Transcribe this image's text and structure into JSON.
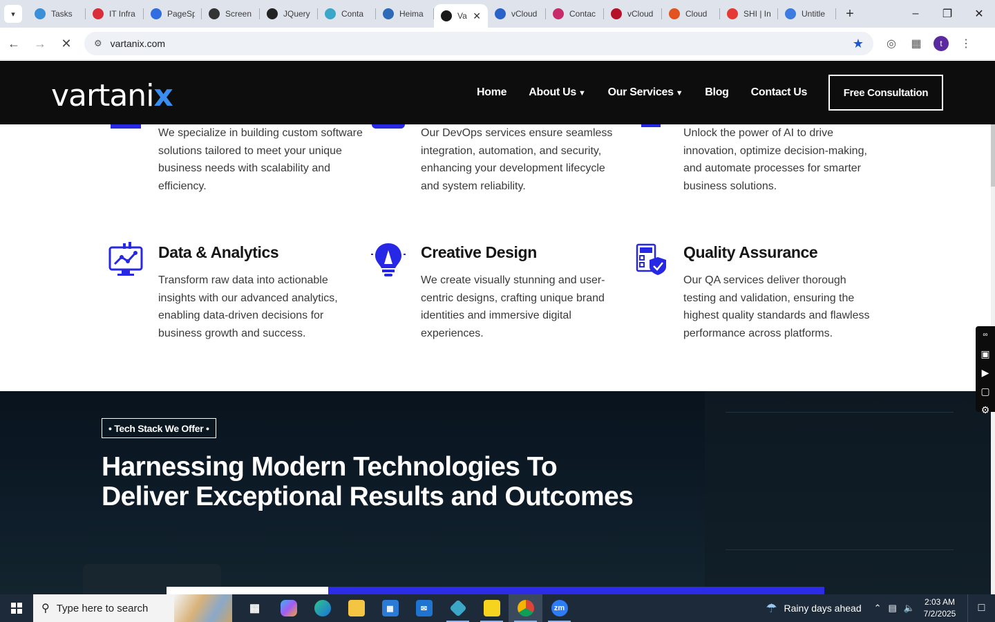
{
  "browser": {
    "tabs": [
      {
        "label": "Tasks",
        "color": "#3b8fd9"
      },
      {
        "label": "IT Infra",
        "color": "#d92d3a"
      },
      {
        "label": "PageSp",
        "color": "#2f6de0"
      },
      {
        "label": "Screen",
        "color": "#333333"
      },
      {
        "label": "JQuery",
        "color": "#222222"
      },
      {
        "label": "Conta",
        "color": "#3aa7c9"
      },
      {
        "label": "Heima",
        "color": "#2d6ab8"
      },
      {
        "label": "Va",
        "color": "#1a1a1a",
        "active": true
      },
      {
        "label": "vCloud",
        "color": "#2962c9"
      },
      {
        "label": "Contac",
        "color": "#c72b6a"
      },
      {
        "label": "vCloud",
        "color": "#b5122a"
      },
      {
        "label": "Cloud",
        "color": "#e2531d"
      },
      {
        "label": "SHI | In",
        "color": "#e53935"
      },
      {
        "label": "Untitle",
        "color": "#3c7be0"
      }
    ],
    "url": "vartanix.com",
    "profile_initial": "t"
  },
  "site": {
    "logo_main": "vartani",
    "logo_x": "x",
    "nav": {
      "home": "Home",
      "about": "About Us",
      "services": "Our Services",
      "blog": "Blog",
      "contact": "Contact Us"
    },
    "cta": "Free Consultation"
  },
  "services": {
    "top_row": [
      {
        "desc": "We specialize in building custom software solutions tailored to meet your unique business needs with scalability and efficiency."
      },
      {
        "desc": "Our DevOps services ensure seamless integration, automation, and security, enhancing your development lifecycle and system reliability."
      },
      {
        "desc": "Unlock the power of AI to drive innovation, optimize decision-making, and automate processes for smarter business solutions."
      }
    ],
    "bottom_row": [
      {
        "title": "Data & Analytics",
        "desc": "Transform raw data into actionable insights with our advanced analytics, enabling data-driven decisions for business growth and success.",
        "icon": "analytics-icon"
      },
      {
        "title": "Creative Design",
        "desc": "We create visually stunning and user-centric designs, crafting unique brand identities and immersive digital experiences.",
        "icon": "lightbulb-icon"
      },
      {
        "title": "Quality Assurance",
        "desc": "Our QA services deliver thorough testing and validation, ensuring the highest quality standards and flawless performance across platforms.",
        "icon": "qa-shield-icon"
      }
    ],
    "accent_color": "#2727e6"
  },
  "tech": {
    "badge": "Tech Stack We Offer",
    "headline_line1": "Harnessing Modern Technologies To",
    "headline_line2": "Deliver Exceptional Results and Outcomes"
  },
  "taskbar": {
    "search_placeholder": "Type here to search",
    "weather": "Rainy days ahead",
    "time": "2:03 AM",
    "date": "7/2/2025"
  }
}
